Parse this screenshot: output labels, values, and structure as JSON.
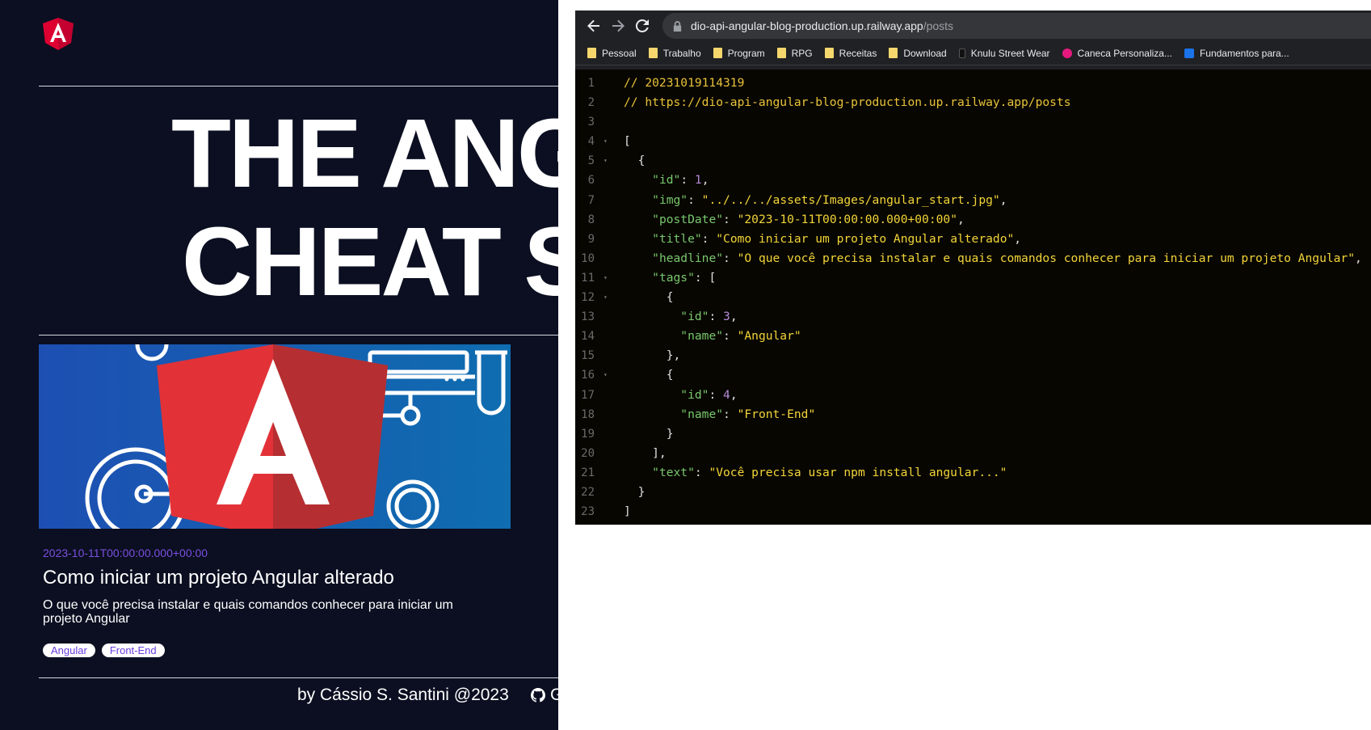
{
  "blog": {
    "hero_line1": "THE ANG",
    "hero_line2": "CHEAT S",
    "post": {
      "date": "2023-10-11T00:00:00.000+00:00",
      "title": "Como iniciar um projeto Angular alterado",
      "headline": "O que você precisa instalar e quais comandos conhecer para iniciar um projeto Angular",
      "tags": [
        "Angular",
        "Front-End"
      ]
    },
    "footer_text": "by Cássio S. Santini @2023",
    "footer_link": "G"
  },
  "browser": {
    "url_host": "dio-api-angular-blog-production.up.railway.app",
    "url_path": "/posts",
    "bookmarks": [
      {
        "label": "Pessoal",
        "icon": "folder-icon"
      },
      {
        "label": "Trabalho",
        "icon": "folder-icon"
      },
      {
        "label": "Program",
        "icon": "folder-icon"
      },
      {
        "label": "RPG",
        "icon": "folder-icon"
      },
      {
        "label": "Receitas",
        "icon": "folder-icon"
      },
      {
        "label": "Download",
        "icon": "folder-icon"
      },
      {
        "label": "Knulu Street Wear",
        "icon": "site-icon"
      },
      {
        "label": "Caneca Personaliza...",
        "icon": "heart-site-icon"
      },
      {
        "label": "Fundamentos para...",
        "icon": "video-site-icon"
      }
    ]
  },
  "code_lines": [
    {
      "n": "1",
      "fold": false,
      "tokens": [
        [
          "c-comment",
          "// 20231019114319"
        ]
      ]
    },
    {
      "n": "2",
      "fold": false,
      "tokens": [
        [
          "c-comment",
          "// https://dio-api-angular-blog-production.up.railway.app/posts"
        ]
      ]
    },
    {
      "n": "3",
      "fold": false,
      "tokens": []
    },
    {
      "n": "4",
      "fold": true,
      "tokens": [
        [
          "c-punc",
          "["
        ]
      ]
    },
    {
      "n": "5",
      "fold": true,
      "tokens": [
        [
          "c-punc",
          "  {"
        ]
      ]
    },
    {
      "n": "6",
      "fold": false,
      "tokens": [
        [
          "c-punc",
          "    "
        ],
        [
          "c-key",
          "\"id\""
        ],
        [
          "c-punc",
          ": "
        ],
        [
          "c-num",
          "1"
        ],
        [
          "c-punc",
          ","
        ]
      ]
    },
    {
      "n": "7",
      "fold": false,
      "tokens": [
        [
          "c-punc",
          "    "
        ],
        [
          "c-key",
          "\"img\""
        ],
        [
          "c-punc",
          ": "
        ],
        [
          "c-str",
          "\"../../../assets/Images/angular_start.jpg\""
        ],
        [
          "c-punc",
          ","
        ]
      ]
    },
    {
      "n": "8",
      "fold": false,
      "tokens": [
        [
          "c-punc",
          "    "
        ],
        [
          "c-key",
          "\"postDate\""
        ],
        [
          "c-punc",
          ": "
        ],
        [
          "c-str",
          "\"2023-10-11T00:00:00.000+00:00\""
        ],
        [
          "c-punc",
          ","
        ]
      ]
    },
    {
      "n": "9",
      "fold": false,
      "tokens": [
        [
          "c-punc",
          "    "
        ],
        [
          "c-key",
          "\"title\""
        ],
        [
          "c-punc",
          ": "
        ],
        [
          "c-str",
          "\"Como iniciar um projeto Angular alterado\""
        ],
        [
          "c-punc",
          ","
        ]
      ]
    },
    {
      "n": "10",
      "fold": false,
      "tokens": [
        [
          "c-punc",
          "    "
        ],
        [
          "c-key",
          "\"headline\""
        ],
        [
          "c-punc",
          ": "
        ],
        [
          "c-str",
          "\"O que você precisa instalar e quais comandos conhecer para iniciar um projeto Angular\""
        ],
        [
          "c-punc",
          ","
        ]
      ]
    },
    {
      "n": "11",
      "fold": true,
      "tokens": [
        [
          "c-punc",
          "    "
        ],
        [
          "c-key",
          "\"tags\""
        ],
        [
          "c-punc",
          ": ["
        ]
      ]
    },
    {
      "n": "12",
      "fold": true,
      "tokens": [
        [
          "c-punc",
          "      {"
        ]
      ]
    },
    {
      "n": "13",
      "fold": false,
      "tokens": [
        [
          "c-punc",
          "        "
        ],
        [
          "c-key",
          "\"id\""
        ],
        [
          "c-punc",
          ": "
        ],
        [
          "c-num",
          "3"
        ],
        [
          "c-punc",
          ","
        ]
      ]
    },
    {
      "n": "14",
      "fold": false,
      "tokens": [
        [
          "c-punc",
          "        "
        ],
        [
          "c-key",
          "\"name\""
        ],
        [
          "c-punc",
          ": "
        ],
        [
          "c-str",
          "\"Angular\""
        ]
      ]
    },
    {
      "n": "15",
      "fold": false,
      "tokens": [
        [
          "c-punc",
          "      },"
        ]
      ]
    },
    {
      "n": "16",
      "fold": true,
      "tokens": [
        [
          "c-punc",
          "      {"
        ]
      ]
    },
    {
      "n": "17",
      "fold": false,
      "tokens": [
        [
          "c-punc",
          "        "
        ],
        [
          "c-key",
          "\"id\""
        ],
        [
          "c-punc",
          ": "
        ],
        [
          "c-num",
          "4"
        ],
        [
          "c-punc",
          ","
        ]
      ]
    },
    {
      "n": "18",
      "fold": false,
      "tokens": [
        [
          "c-punc",
          "        "
        ],
        [
          "c-key",
          "\"name\""
        ],
        [
          "c-punc",
          ": "
        ],
        [
          "c-str",
          "\"Front-End\""
        ]
      ]
    },
    {
      "n": "19",
      "fold": false,
      "tokens": [
        [
          "c-punc",
          "      }"
        ]
      ]
    },
    {
      "n": "20",
      "fold": false,
      "tokens": [
        [
          "c-punc",
          "    ],"
        ]
      ]
    },
    {
      "n": "21",
      "fold": false,
      "tokens": [
        [
          "c-punc",
          "    "
        ],
        [
          "c-key",
          "\"text\""
        ],
        [
          "c-punc",
          ": "
        ],
        [
          "c-str",
          "\"Você precisa usar npm install angular...\""
        ]
      ]
    },
    {
      "n": "22",
      "fold": false,
      "tokens": [
        [
          "c-punc",
          "  }"
        ]
      ]
    },
    {
      "n": "23",
      "fold": false,
      "tokens": [
        [
          "c-punc",
          "]"
        ]
      ]
    }
  ],
  "colors": {
    "blog_bg": "#0b0f21",
    "accent_purple": "#7b4fe0",
    "angular_red": "#dd0031",
    "code_bg": "#080600",
    "json_key": "#78c86e",
    "json_string": "#f2d53a",
    "json_number": "#b48ad9"
  }
}
